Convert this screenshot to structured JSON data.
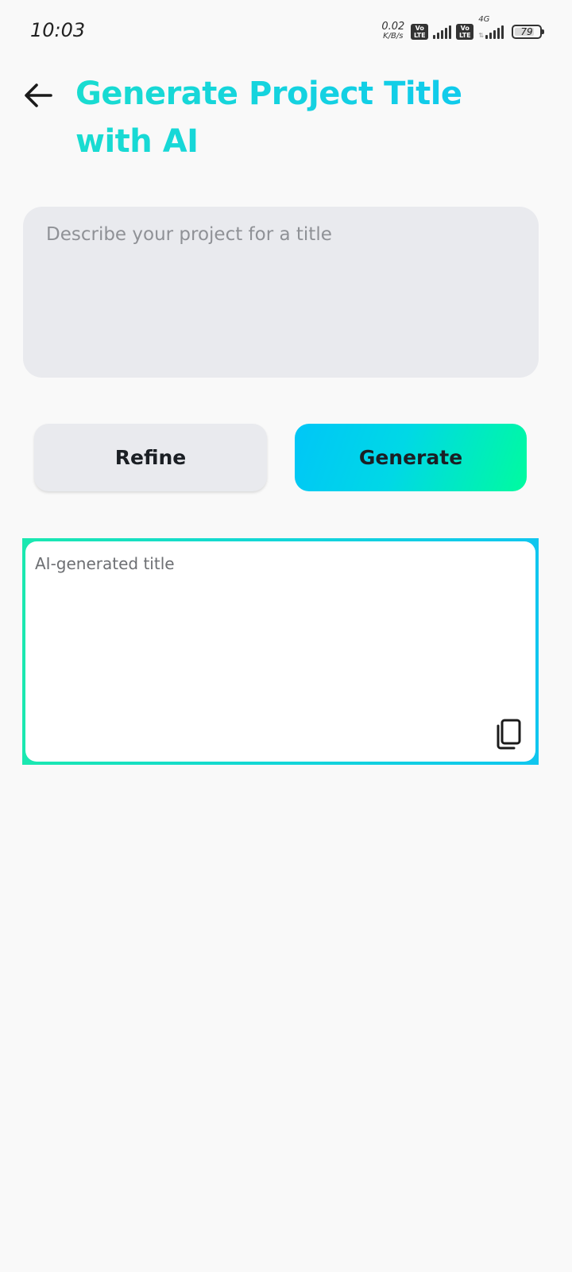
{
  "status_bar": {
    "time": "10:03",
    "net_speed_value": "0.02",
    "net_speed_unit": "K/B/s",
    "volte_1": "Vo LTE",
    "volte_2": "Vo LTE",
    "network_type": "4G",
    "battery_percent": "79",
    "battery_level": 0.79
  },
  "header": {
    "back_icon": "arrow-left-icon",
    "title": "Generate Project Title with AI",
    "title_gradient": [
      "#19dcd0",
      "#0fc8f0"
    ]
  },
  "description_input": {
    "placeholder": "Describe your project for a title",
    "value": ""
  },
  "actions": {
    "refine_label": "Refine",
    "generate_label": "Generate",
    "generate_gradient": [
      "#00c6f7",
      "#00fb9f"
    ]
  },
  "output": {
    "placeholder": "AI-generated title",
    "value": "",
    "copy_icon": "copy-icon",
    "border_gradient": [
      "#1ae8b0",
      "#10c6ef"
    ]
  }
}
